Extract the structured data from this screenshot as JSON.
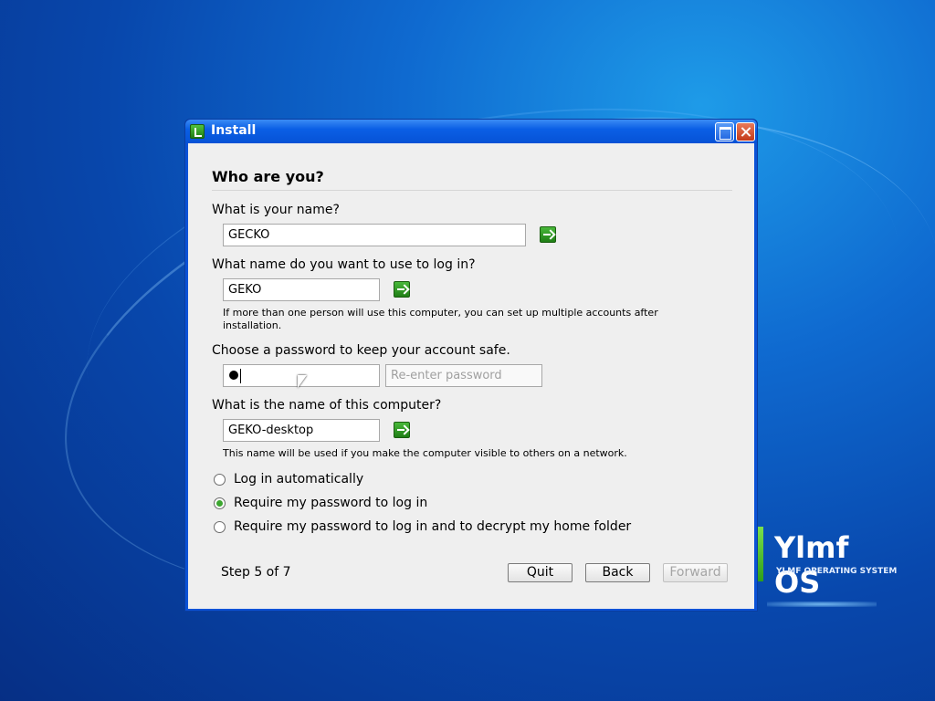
{
  "window": {
    "title": "Install"
  },
  "page": {
    "heading": "Who are you?",
    "name_label": "What is your name?",
    "name_value": "GECKO",
    "login_label": "What name do you want to use to log in?",
    "login_value": "GEKO",
    "login_hint_line1": "If more than one person will use this computer, you can set up multiple accounts after",
    "login_hint_line2": "installation.",
    "password_label": "Choose a password to keep your account safe.",
    "password_reenter_placeholder": "Re-enter password",
    "computer_label": "What is the name of this computer?",
    "computer_value": "GEKO-desktop",
    "computer_hint": "This name will be used if you make the computer visible to others on a network."
  },
  "login_options": [
    {
      "label": "Log in automatically",
      "checked": false
    },
    {
      "label": "Require my password to log in",
      "checked": true
    },
    {
      "label": "Require my password to log in and to decrypt my home folder",
      "checked": false
    }
  ],
  "footer": {
    "step_text": "Step 5 of 7",
    "quit_label": "Quit",
    "back_label": "Back",
    "forward_label": "Forward"
  },
  "desktop": {
    "brand_name": "Ylmf OS",
    "brand_sub": "YLMF OPERATING SYSTEM"
  },
  "icons": [
    "app-icon",
    "maximize-icon",
    "close-icon",
    "arrow-right-icon",
    "mouse-cursor-icon"
  ],
  "colors": {
    "titlebar": "#0652d6",
    "go_button": "#2f9a22",
    "radio_checked": "#3ca630"
  }
}
